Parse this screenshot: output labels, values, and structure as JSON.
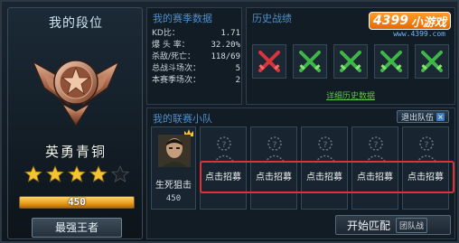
{
  "left_panel": {
    "title": "我的段位",
    "rank_name": "英勇青铜",
    "stars_filled": 4,
    "stars_total": 5,
    "exp_value": "450",
    "exp_fill_percent": 100,
    "king_button": "最强王者"
  },
  "stats": {
    "title": "我的赛季数据",
    "rows": [
      {
        "label": "KD比：",
        "value": "1.71"
      },
      {
        "label": "爆 头 率：",
        "value": "32.20%"
      },
      {
        "label": "杀敌/死亡：",
        "value": "118/69"
      },
      {
        "label": "总战斗场次：",
        "value": "5"
      },
      {
        "label": "本赛季场次：",
        "value": "2"
      }
    ]
  },
  "history": {
    "title": "历史战绩",
    "logo_text": "4399",
    "logo_cn": "小游戏",
    "logo_url": "www.4399.com",
    "results": [
      "loss",
      "win",
      "win",
      "win",
      "win"
    ],
    "link": "详细历史数据"
  },
  "team": {
    "title": "我的联赛小队",
    "quit_label": "退出队伍",
    "leader": {
      "name": "生死狙击",
      "score": "450"
    },
    "recruit_label": "点击招募",
    "slots": 5,
    "start_label": "开始匹配",
    "mode_label": "团队战"
  },
  "colors": {
    "accent_blue": "#4f8fcc",
    "win_green": "#3fb648",
    "loss_red": "#d8343c",
    "highlight_red": "#e0303a",
    "exp_orange": "#e89a18"
  }
}
